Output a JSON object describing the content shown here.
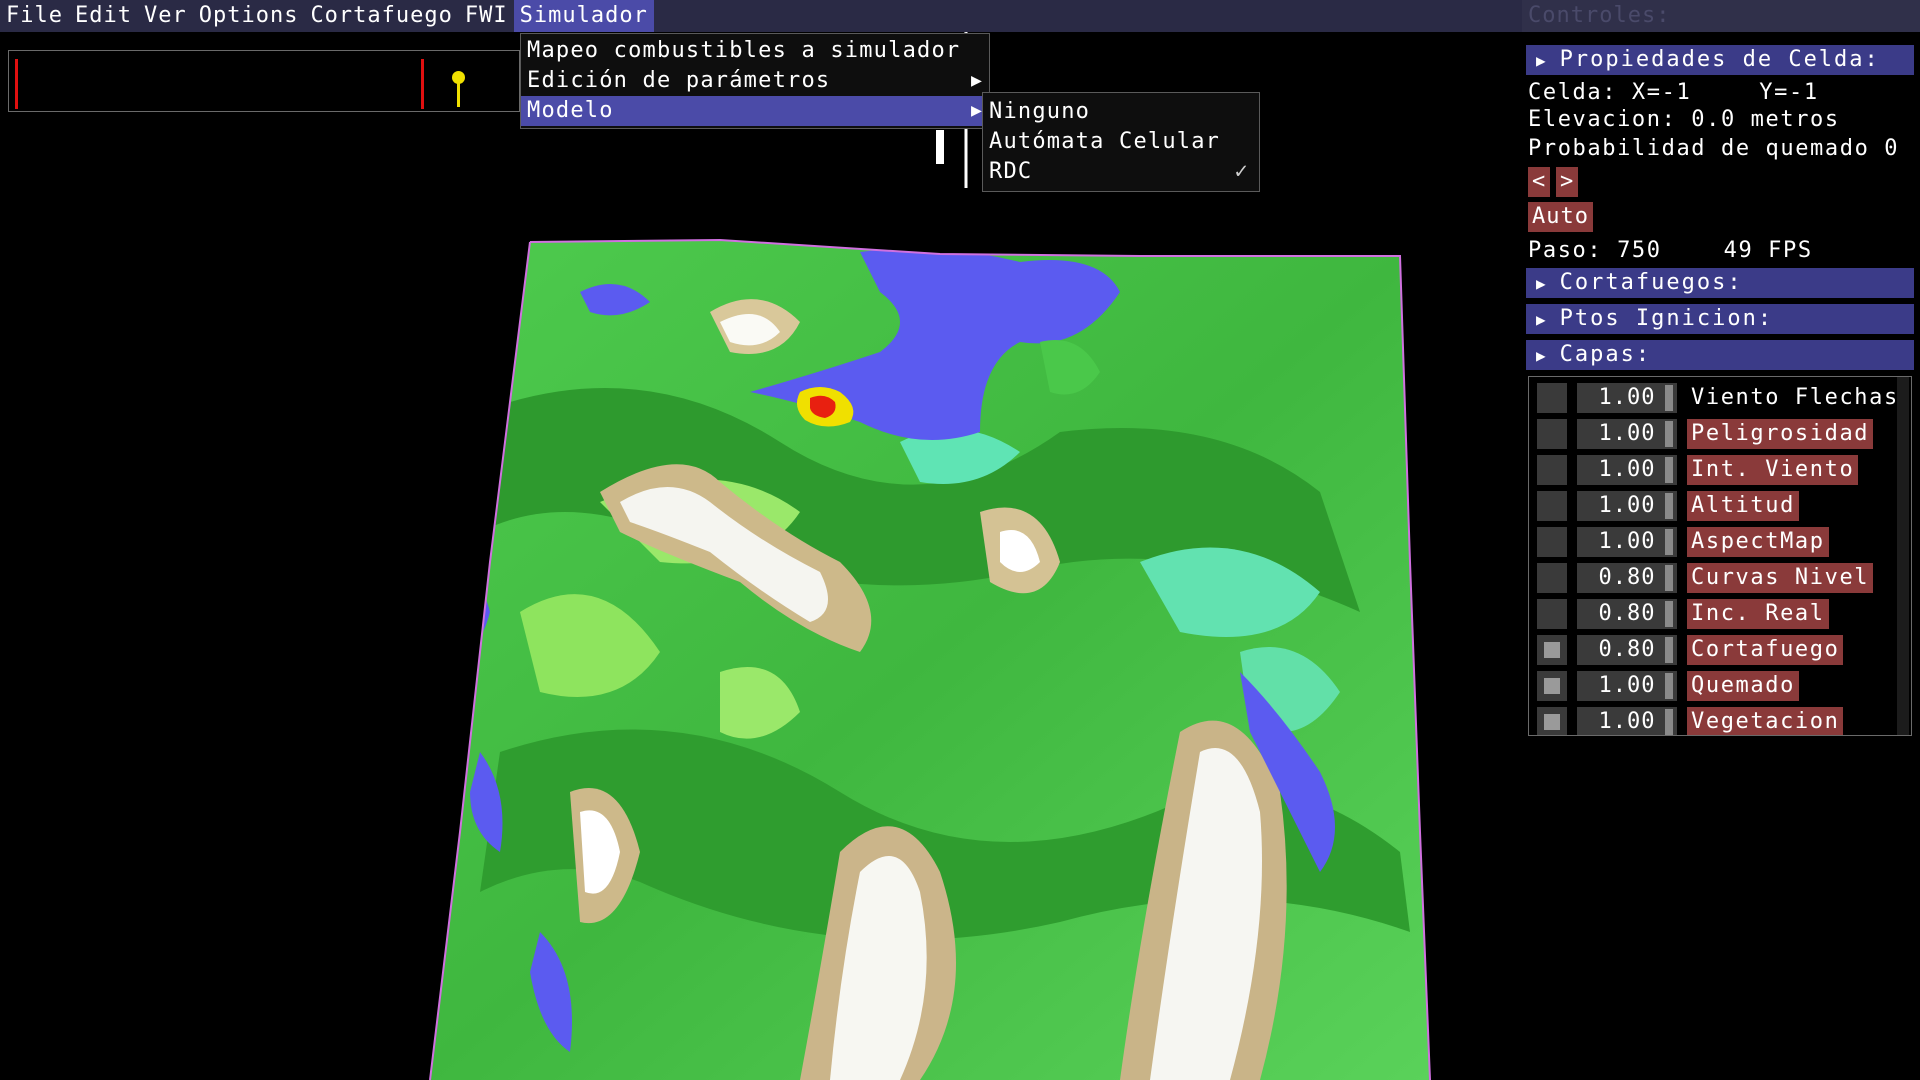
{
  "menubar": {
    "items": [
      "File",
      "Edit",
      "Ver",
      "Options",
      "Cortafuego",
      "FWI",
      "Simulador"
    ]
  },
  "simulador_menu": {
    "items": [
      {
        "label": "Mapeo combustibles a simulador",
        "submenu": false
      },
      {
        "label": "Edición de parámetros",
        "submenu": true
      },
      {
        "label": "Modelo",
        "submenu": true
      }
    ]
  },
  "modelo_menu": {
    "items": [
      {
        "label": "Ninguno",
        "checked": false
      },
      {
        "label": "Autómata Celular",
        "checked": false
      },
      {
        "label": "RDC",
        "checked": true
      }
    ]
  },
  "panel": {
    "title": "Controles:",
    "cell_header": "Propiedades de Celda:",
    "cell_label": "Celda: X=-1",
    "cell_y": "Y=-1",
    "elevation": "Elevacion: 0.0 metros",
    "burn_prob": "Probabilidad de quemado 0",
    "prev_label": "<",
    "next_label": ">",
    "auto_label": "Auto",
    "step": "Paso: 750",
    "fps": "49 FPS",
    "firebreaks_header": "Cortafuegos:",
    "ignition_header": "Ptos Ignicion:",
    "layers_header": "Capas:"
  },
  "layers": [
    {
      "value": "1.00",
      "name": "Viento Flechas",
      "checked": false,
      "tag": false
    },
    {
      "value": "1.00",
      "name": "Peligrosidad",
      "checked": false,
      "tag": true
    },
    {
      "value": "1.00",
      "name": "Int. Viento",
      "checked": false,
      "tag": true
    },
    {
      "value": "1.00",
      "name": "Altitud",
      "checked": false,
      "tag": true
    },
    {
      "value": "1.00",
      "name": "AspectMap",
      "checked": false,
      "tag": true
    },
    {
      "value": "0.80",
      "name": "Curvas Nivel",
      "checked": false,
      "tag": true
    },
    {
      "value": "0.80",
      "name": "Inc. Real",
      "checked": false,
      "tag": true
    },
    {
      "value": "0.80",
      "name": "Cortafuego",
      "checked": true,
      "tag": true
    },
    {
      "value": "1.00",
      "name": "Quemado",
      "checked": true,
      "tag": true
    },
    {
      "value": "1.00",
      "name": "Vegetacion",
      "checked": true,
      "tag": true
    }
  ],
  "colors": {
    "menubar_bg": "#2a2a45",
    "highlight": "#4b4ba8",
    "header_bg": "#3b3b88",
    "button_bg": "#8a3a3a",
    "terrain_green": "#52d052",
    "water": "#5a5af0",
    "fire": "#e82010"
  }
}
